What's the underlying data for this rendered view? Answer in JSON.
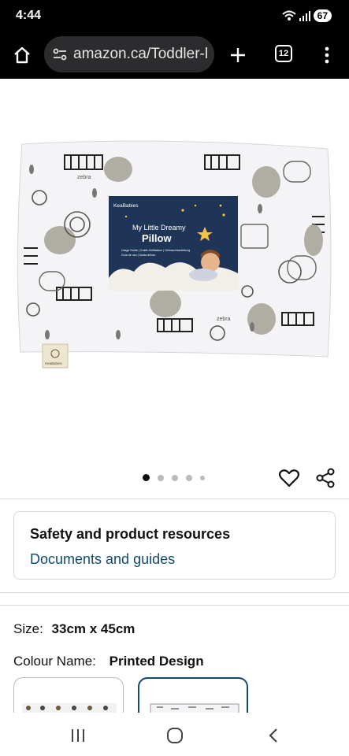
{
  "status_bar": {
    "time": "4:44",
    "battery": "67"
  },
  "browser": {
    "url": "amazon.ca/Toddler-l",
    "tab_count": "12"
  },
  "product_image": {
    "package_brand": "KeaBabies",
    "package_title_line1": "My Little Dreamy",
    "package_title_line2": "Pillow",
    "package_subtitle": "Usage Guide | Guide d'utilisation | Gebrauchsanleitung",
    "package_subtitle2": "Guía de uso | Guida all'uso",
    "tag_brand": "KeaBabies",
    "print_word": "zebra"
  },
  "carousel": {
    "total": 5,
    "active_index": 0
  },
  "safety": {
    "title": "Safety and product resources",
    "link": "Documents and guides"
  },
  "size": {
    "label": "Size:",
    "value": "33cm x 45cm"
  },
  "colour": {
    "label": "Colour Name:",
    "value": "Printed Design"
  },
  "colors": {
    "link": "#0f4a6e",
    "selected_border": "#0f4a6e",
    "package_navy": "#1f3557",
    "star": "#f5c242"
  }
}
